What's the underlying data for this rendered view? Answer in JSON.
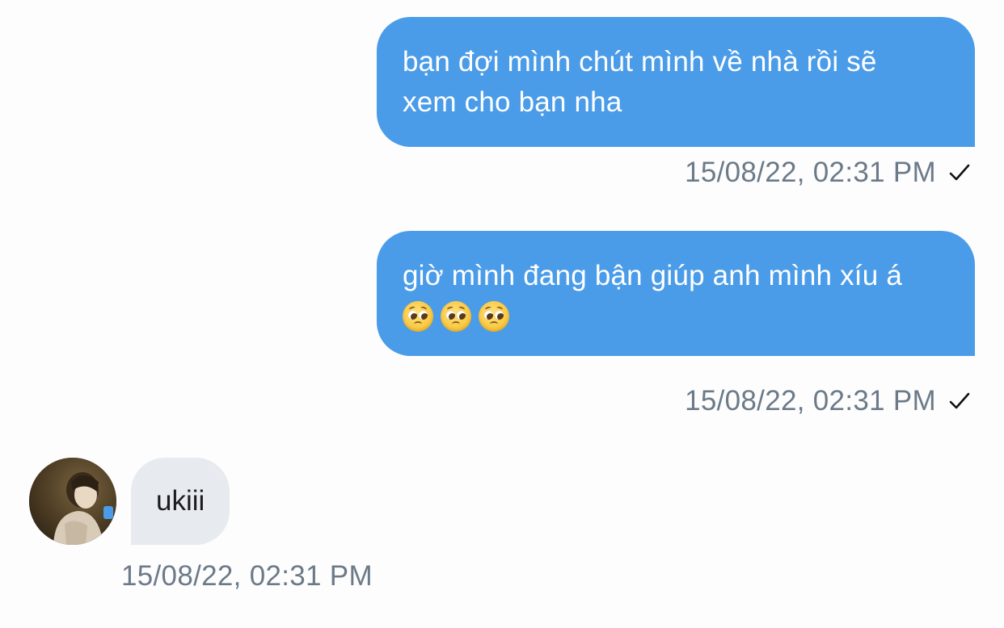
{
  "messages": {
    "outgoing": [
      {
        "lines": [
          "bạn đợi mình chút mình về nhà rồi sẽ",
          "xem cho bạn nha"
        ],
        "timestamp": "15/08/22, 02:31 PM"
      },
      {
        "lines": [
          "giờ mình đang bận giúp anh mình xíu á"
        ],
        "emojis": [
          "pleading-face",
          "pleading-face",
          "pleading-face"
        ],
        "timestamp": "15/08/22, 02:31 PM"
      }
    ],
    "incoming": [
      {
        "text": "ukiii",
        "timestamp": "15/08/22, 02:31 PM"
      }
    ]
  },
  "colors": {
    "outgoing_bubble": "#4B9CE8",
    "incoming_bubble": "#E7EAEF",
    "timestamp": "#6C7A88",
    "background": "#FDFDFE"
  },
  "icons": {
    "read_receipt": "check-icon",
    "emoji": "pleading-face-icon"
  }
}
